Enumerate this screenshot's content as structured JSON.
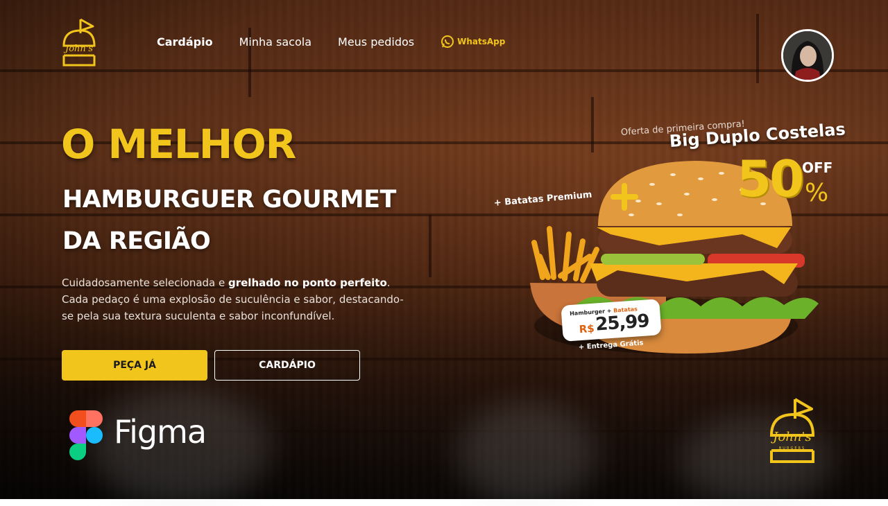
{
  "brand": {
    "name": "John's",
    "subtitle": "BURGERS"
  },
  "nav": {
    "items": [
      {
        "label": "Cardápio",
        "active": true
      },
      {
        "label": "Minha sacola",
        "active": false
      },
      {
        "label": "Meus pedidos",
        "active": false
      }
    ],
    "whatsapp": {
      "label": "WhatsApp",
      "icon": "whatsapp-icon"
    }
  },
  "user": {
    "avatar": "user-avatar"
  },
  "hero": {
    "headline": "O MELHOR",
    "line1": "HAMBURGUER GOURMET",
    "line2": "DA REGIÃO",
    "desc_part1": "Cuidadosamente selecionada e ",
    "desc_bold": "grelhado no ponto perfeito",
    "desc_part2": ".",
    "desc_rest": "Cada pedaço é uma explosão de suculência e sabor, destacando-se pela sua textura suculenta e sabor inconfundível.",
    "cta_primary": "PEÇA JÁ",
    "cta_secondary": "CARDÁPIO"
  },
  "promo": {
    "kicker": "Oferta de primeira compra!",
    "title": "Big Duplo Costelas",
    "discount_value": "50",
    "discount_off": "OFF",
    "discount_pct": "%",
    "extra": "+ Batatas Premium",
    "price_label_a": "Hamburger + ",
    "price_label_b": "Batatas",
    "price_currency": "R$",
    "price_value": "25,99",
    "delivery": "+ Entrega Grátis"
  },
  "footer": {
    "tool": "Figma"
  },
  "colors": {
    "accent": "#f2c51c",
    "text": "#ffffff",
    "orange": "#e0620e"
  }
}
